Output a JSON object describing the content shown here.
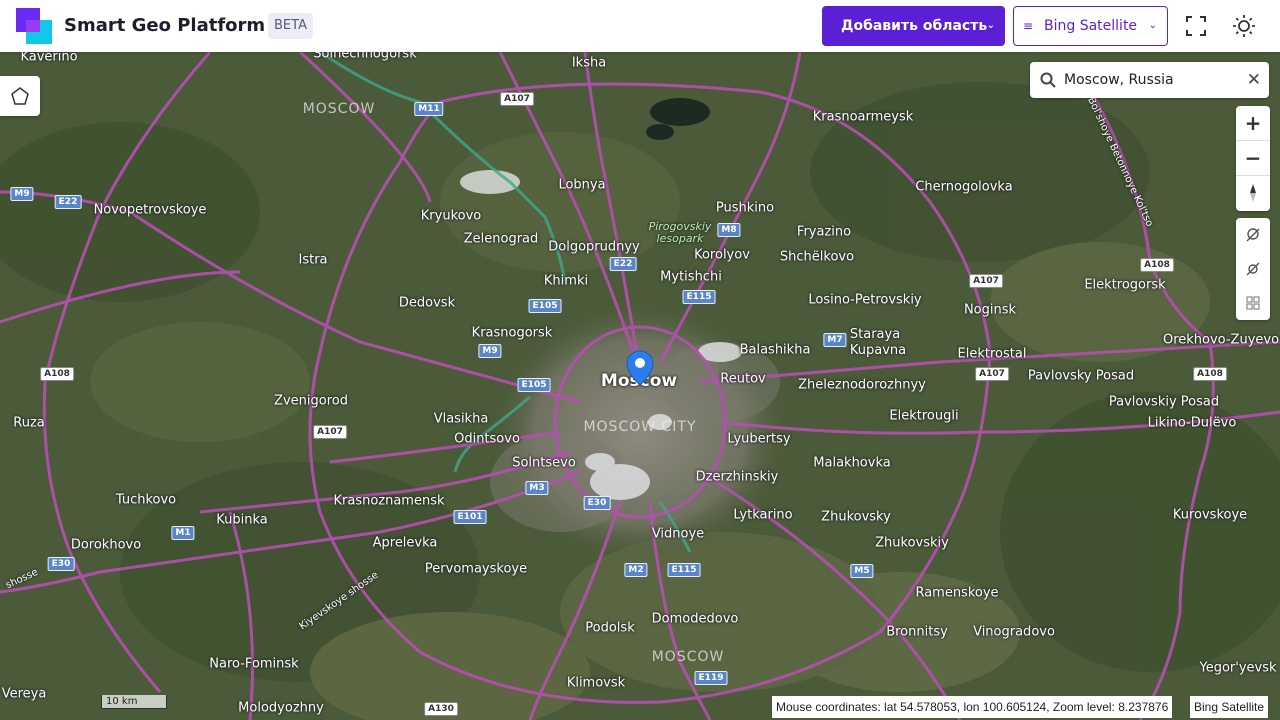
{
  "header": {
    "app_title": "Smart Geo Platform",
    "beta_badge": "BETA",
    "add_area_label": "Добавить область",
    "layer_label": "Bing Satellite"
  },
  "search": {
    "value": "Moscow, Russia",
    "placeholder": ""
  },
  "map": {
    "marker_label": "Moscow",
    "scale_label": "10 km",
    "status": "Mouse coordinates: lat 54.578053, lon 100.605124, Zoom level: 8.237876",
    "attribution": "Bing Satellite",
    "places": [
      "Kaverino",
      "Solnechnogorsk",
      "Iksha",
      "MOSCOW",
      "Krasnoarmeysk",
      "Lobnya",
      "Pushkino",
      "Chernogolovka",
      "Kryukovo",
      "Novopetrovskoye",
      "Zelenograd",
      "Dolgoprudnyy",
      "Pirogovskiy lesopark",
      "Fryazino",
      "Istra",
      "Khimki",
      "Mytishchi",
      "Korolyov",
      "Shchëlkovo",
      "Elektrogorsk",
      "Dedovsk",
      "Losino-Petrovskiy",
      "Noginsk",
      "Krasnogorsk",
      "Staraya Kupavna",
      "Orekhovo-Zuyevo",
      "Balashikha",
      "Elektrostal",
      "Moscow",
      "Reutov",
      "Zheleznodorozhnyy",
      "Pavlovsky Posad",
      "Zvenigorod",
      "Pavlovskiy Posad",
      "Ruza",
      "Vlasikha",
      "MOSCOW CITY",
      "Elektrougli",
      "Likino-Dulëvo",
      "Odintsovo",
      "Lyubertsy",
      "Solntsevo",
      "Malakhovka",
      "Tuchkovo",
      "Dzerzhinskiy",
      "Krasnoznamensk",
      "Kurovskoye",
      "Kubinka",
      "Lytkarino",
      "Zhukovsky",
      "Vidnoye",
      "Dorokhovo",
      "Aprelevka",
      "Zhukovskiy",
      "Pervomayskoye",
      "Ramenskoye",
      "Podolsk",
      "Domodedovo",
      "Bronnitsy",
      "Vinogradovo",
      "MOSCOW",
      "Naro-Fominsk",
      "Klimovsk",
      "Yegor'yevsk",
      "Vereya",
      "Molodyozhny"
    ],
    "road_shields": [
      "M11",
      "A107",
      "M9",
      "E22",
      "M8",
      "E22",
      "E105",
      "E115",
      "A107",
      "A108",
      "M9",
      "M7",
      "A108",
      "E105",
      "A107",
      "A107",
      "A108",
      "M3",
      "E30",
      "E101",
      "M1",
      "E30",
      "M2",
      "E115",
      "M5",
      "E119",
      "A130"
    ],
    "road_names": [
      "Kiyevskoye shosse",
      "shosse",
      "Bol'shoye Betonnoye Kol'tso"
    ]
  }
}
